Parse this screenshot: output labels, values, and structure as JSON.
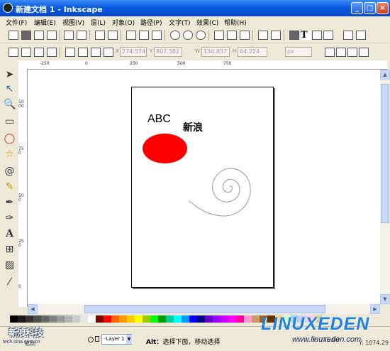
{
  "window": {
    "title": "新建文档 1 - Inkscape",
    "minimize": "_",
    "maximize": "□",
    "close": "×"
  },
  "menu": [
    "文件(F)",
    "编辑(E)",
    "视图(V)",
    "层(L)",
    "对象(O)",
    "路径(P)",
    "文字(T)",
    "效果(C)",
    "帮助(H)"
  ],
  "toolbar2": {
    "x_label": "X",
    "x_value": "274.574",
    "y_label": "Y",
    "y_value": "807.582",
    "w_label": "W",
    "w_value": "134.857",
    "h_label": "H",
    "h_value": "64.224",
    "unit": "px"
  },
  "ruler_top": [
    "-250",
    "0",
    "250",
    "500",
    "750"
  ],
  "ruler_left": [
    "1000",
    "750",
    "500",
    "250",
    "0"
  ],
  "canvas": {
    "text_abc": "ABC",
    "text_cn": "新浪",
    "ellipse_color": "#ff0000"
  },
  "palette": [
    "#000000",
    "#1a1a1a",
    "#333333",
    "#4d4d4d",
    "#666666",
    "#808080",
    "#999999",
    "#b3b3b3",
    "#cccccc",
    "#e6e6e6",
    "#ffffff",
    "#800000",
    "#ff0000",
    "#ff6600",
    "#ff9900",
    "#ffcc00",
    "#ffff00",
    "#99cc00",
    "#00ff00",
    "#009900",
    "#00cc99",
    "#00ffff",
    "#0099ff",
    "#0000ff",
    "#000080",
    "#6600cc",
    "#9900ff",
    "#cc00ff",
    "#ff00ff",
    "#ff0099",
    "#ff99cc",
    "#cc9966",
    "#996633",
    "#663300",
    "#ffcc99",
    "#ccffcc",
    "#99ccff",
    "#ccccff",
    "#ffccff",
    "#cccc99"
  ],
  "status": {
    "fill_label": "填充",
    "stroke_label": "笔刷",
    "layer": "-Layer 1",
    "message_bold": "Alt：",
    "message": "选择下面，移动选择",
    "coords": "X: 775.00",
    "zoom": "Y: 1074.29"
  },
  "watermark": {
    "left": "新浪科技",
    "left_sub": "tech.sina.com.cn",
    "logo": "LINUXEDEN",
    "url": "www.linuxeden.com"
  }
}
